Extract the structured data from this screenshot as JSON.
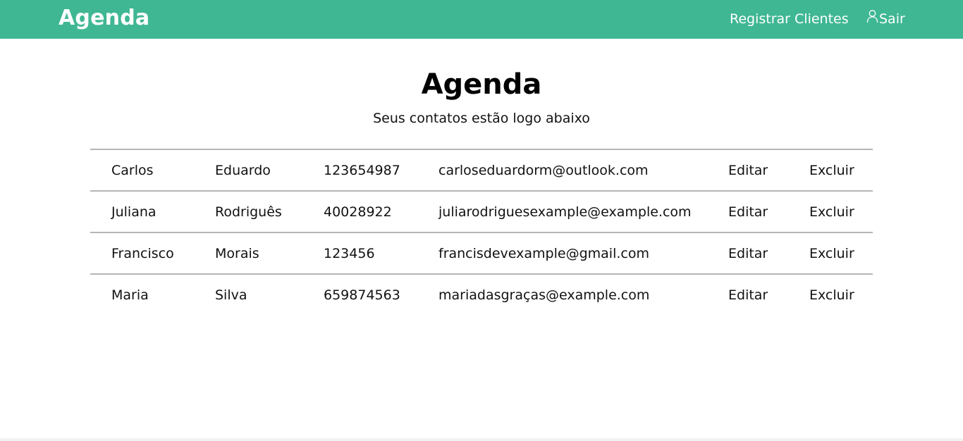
{
  "navbar": {
    "brand": "Agenda",
    "register_label": "Registrar Clientes",
    "logout_label": "Sair",
    "accent_color": "#3fb793"
  },
  "main": {
    "title": "Agenda",
    "subtitle": "Seus contatos estão logo abaixo"
  },
  "contacts": [
    {
      "first": "Carlos",
      "last": "Eduardo",
      "phone": "123654987",
      "email": "carloseduardorm@outlook.com",
      "edit": "Editar",
      "delete": "Excluir"
    },
    {
      "first": "Juliana",
      "last": "Rodriguês",
      "phone": "40028922",
      "email": "juliarodriguesexample@example.com",
      "edit": "Editar",
      "delete": "Excluir"
    },
    {
      "first": "Francisco",
      "last": "Morais",
      "phone": "123456",
      "email": "francisdevexample@gmail.com",
      "edit": "Editar",
      "delete": "Excluir"
    },
    {
      "first": "Maria",
      "last": "Silva",
      "phone": "659874563",
      "email": "mariadasgraças@example.com",
      "edit": "Editar",
      "delete": "Excluir"
    }
  ]
}
